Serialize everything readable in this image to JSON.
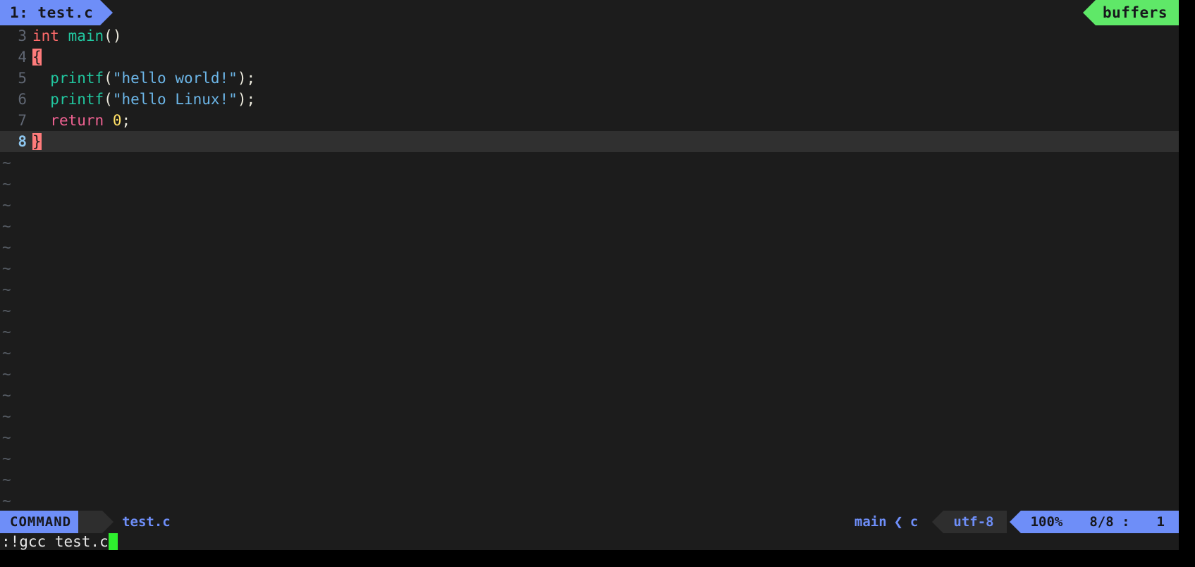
{
  "tabline": {
    "tab_label": "1: test.c",
    "buffers_label": "buffers",
    "tab_bg": "#6e8ef8",
    "buffers_bg": "#5fe868"
  },
  "editor": {
    "lines": [
      {
        "number": "3",
        "current": false,
        "tokens": [
          {
            "text": "int",
            "cls": "tok-type"
          },
          {
            "text": " ",
            "cls": "tok-punct"
          },
          {
            "text": "main",
            "cls": "tok-fn"
          },
          {
            "text": "()",
            "cls": "tok-punct"
          }
        ]
      },
      {
        "number": "4",
        "current": false,
        "tokens": [
          {
            "text": "{",
            "cls": "tok-match"
          }
        ]
      },
      {
        "number": "5",
        "current": false,
        "tokens": [
          {
            "text": "  ",
            "cls": "tok-punct"
          },
          {
            "text": "printf",
            "cls": "tok-fn"
          },
          {
            "text": "(",
            "cls": "tok-punct"
          },
          {
            "text": "\"hello world!\"",
            "cls": "tok-string"
          },
          {
            "text": ");",
            "cls": "tok-punct"
          }
        ]
      },
      {
        "number": "6",
        "current": false,
        "tokens": [
          {
            "text": "  ",
            "cls": "tok-punct"
          },
          {
            "text": "printf",
            "cls": "tok-fn"
          },
          {
            "text": "(",
            "cls": "tok-punct"
          },
          {
            "text": "\"hello Linux!\"",
            "cls": "tok-string"
          },
          {
            "text": ");",
            "cls": "tok-punct"
          }
        ]
      },
      {
        "number": "7",
        "current": false,
        "tokens": [
          {
            "text": "  ",
            "cls": "tok-punct"
          },
          {
            "text": "return",
            "cls": "tok-kw"
          },
          {
            "text": " ",
            "cls": "tok-punct"
          },
          {
            "text": "0",
            "cls": "tok-num"
          },
          {
            "text": ";",
            "cls": "tok-punct"
          }
        ]
      },
      {
        "number": "8",
        "current": true,
        "tokens": [
          {
            "text": "}",
            "cls": "tok-match"
          }
        ]
      }
    ],
    "filler_marker": "~",
    "filler_count": 18
  },
  "statusline": {
    "mode": "COMMAND",
    "filename": "test.c",
    "git_branch": "main",
    "branch_separator": "❮",
    "filetype": "c",
    "encoding": "utf-8",
    "percent": "100%",
    "line_position": "8/8 :",
    "column": "1"
  },
  "cmdline": {
    "text": ":!gcc test.c"
  }
}
